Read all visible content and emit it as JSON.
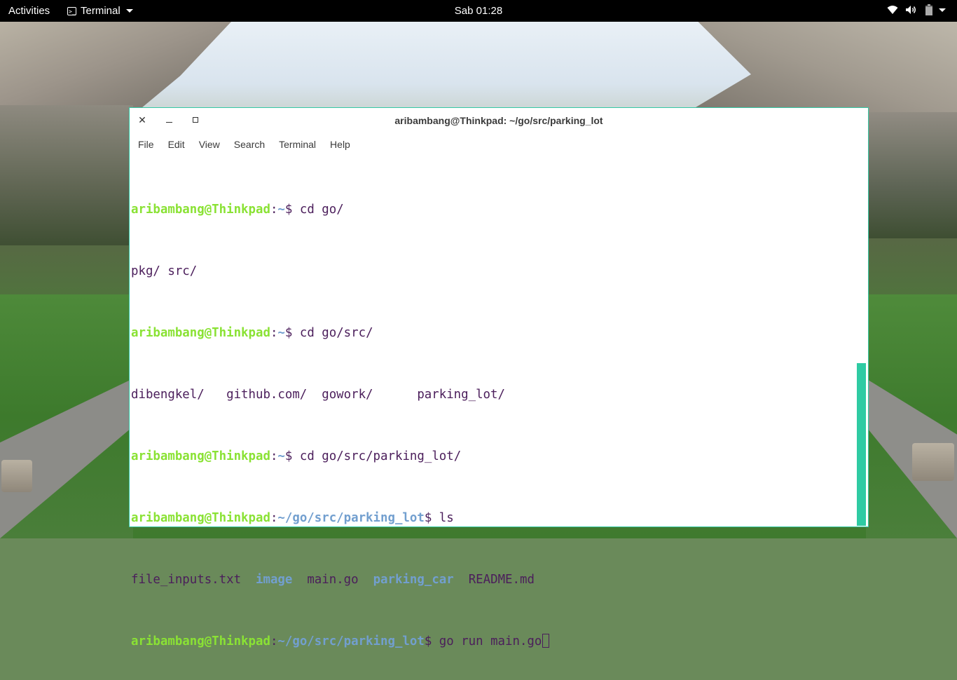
{
  "topbar": {
    "activities": "Activities",
    "app_name": "Terminal",
    "clock": "Sab 01:28",
    "tray_icons": [
      "wifi-icon",
      "volume-icon",
      "battery-icon",
      "chevron-down-icon"
    ]
  },
  "window": {
    "title": "aribambang@Thinkpad: ~/go/src/parking_lot",
    "buttons": [
      "close",
      "minimize",
      "maximize"
    ],
    "menu": [
      "File",
      "Edit",
      "View",
      "Search",
      "Terminal",
      "Help"
    ]
  },
  "terminal": {
    "lines": [
      {
        "user": "aribambang@Thinkpad",
        "colon": ":",
        "path": "~",
        "prompt": "$ ",
        "cmd": "cd go/"
      },
      {
        "out": "pkg/ src/"
      },
      {
        "user": "aribambang@Thinkpad",
        "colon": ":",
        "path": "~",
        "prompt": "$ ",
        "cmd": "cd go/src/"
      },
      {
        "out": "dibengkel/   github.com/  gowork/      parking_lot/"
      },
      {
        "user": "aribambang@Thinkpad",
        "colon": ":",
        "path": "~",
        "prompt": "$ ",
        "cmd": "cd go/src/parking_lot/"
      },
      {
        "user": "aribambang@Thinkpad",
        "colon": ":",
        "path": "~/go/src/parking_lot",
        "prompt": "$ ",
        "cmd": "ls"
      },
      {
        "ls": [
          "file_inputs.txt",
          "image",
          "main.go",
          "parking_car",
          "README.md"
        ],
        "ls_sep": "  "
      },
      {
        "user": "aribambang@Thinkpad",
        "colon": ":",
        "path": "~/go/src/parking_lot",
        "prompt": "$ ",
        "cmd": "go run main.go"
      }
    ]
  },
  "colors": {
    "accent": "#35c9a5",
    "prompt_user": "#8ae234",
    "prompt_path": "#729fcf",
    "text": "#4b1e5b"
  }
}
